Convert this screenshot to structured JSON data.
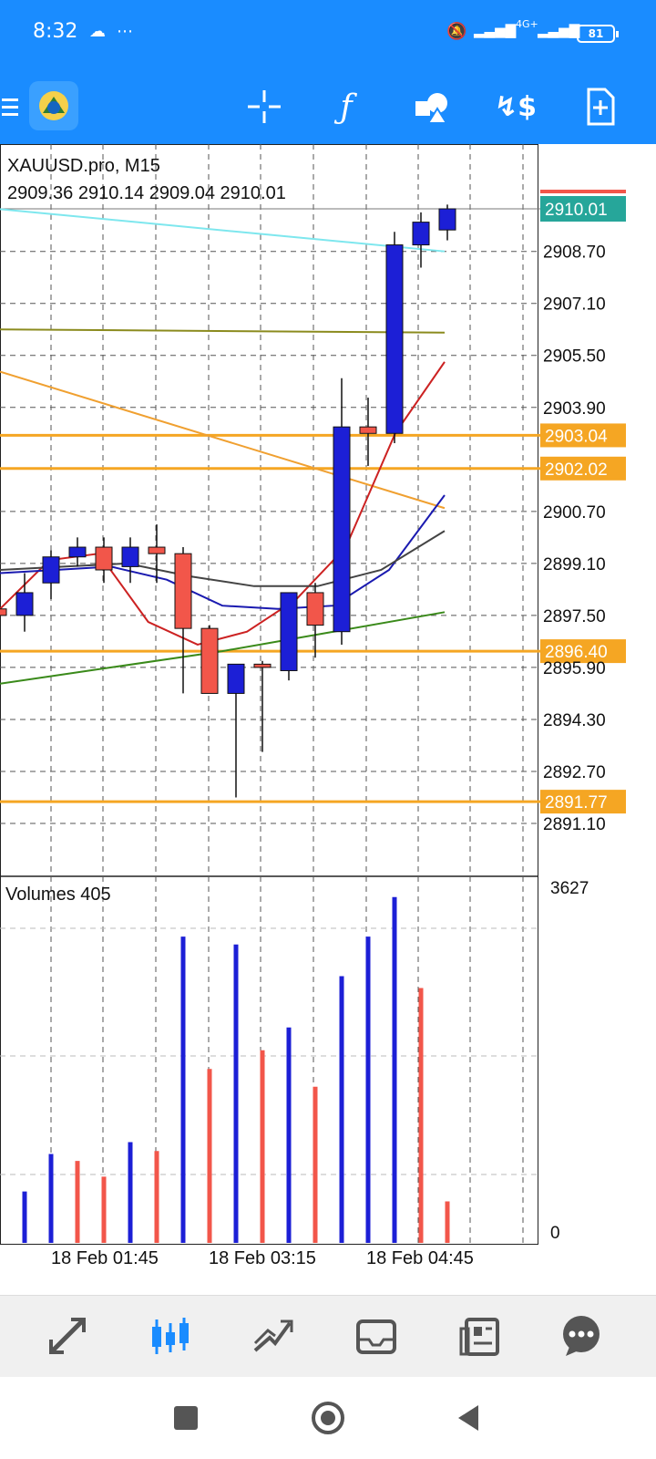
{
  "status_bar": {
    "time": "8:32",
    "network": "4G+",
    "battery": "81",
    "icons": [
      "cloud-game-icon",
      "more-dots-icon",
      "bell-muted-icon",
      "signal-icon",
      "signal-icon"
    ]
  },
  "toolbar": {
    "icons": [
      "menu-icon",
      "metatrader-logo",
      "crosshair-icon",
      "indicators-icon",
      "objects-icon",
      "trade-icon",
      "new-order-icon"
    ]
  },
  "chart": {
    "symbol": "XAUUSD.pro, M15",
    "ohlc": "2909.36 2910.14 2909.04 2910.01",
    "current_price": "2910.01",
    "price_ticks": [
      "2908.70",
      "2907.10",
      "2905.50",
      "2903.90",
      "2900.70",
      "2899.10",
      "2897.50",
      "2895.90",
      "2894.30",
      "2892.70",
      "2891.10"
    ],
    "levels": [
      {
        "label": "2903.04",
        "value": 2903.04
      },
      {
        "label": "2902.02",
        "value": 2902.02
      },
      {
        "label": "2896.40",
        "value": 2896.4
      },
      {
        "label": "2891.77",
        "value": 2891.77
      }
    ],
    "time_labels": [
      "18 Feb 01:45",
      "18 Feb 03:15",
      "18 Feb 04:45"
    ],
    "volumes_title": "Volumes 405",
    "volume_max_label": "3627",
    "volume_min_label": "0",
    "colors": {
      "bull": "#1c1fd6",
      "bear": "#f2564a",
      "level": "#f5a623",
      "price_tag": "#26a69a"
    }
  },
  "chart_data": {
    "type": "candlestick",
    "title": "XAUUSD.pro, M15",
    "ylim": [
      2890.5,
      2911.0
    ],
    "candles": [
      {
        "o": 2897.7,
        "h": 2898.3,
        "l": 2897.0,
        "c": 2897.5
      },
      {
        "o": 2897.5,
        "h": 2898.8,
        "l": 2897.0,
        "c": 2898.2
      },
      {
        "o": 2898.5,
        "h": 2899.5,
        "l": 2898.0,
        "c": 2899.3
      },
      {
        "o": 2899.3,
        "h": 2899.9,
        "l": 2899.0,
        "c": 2899.6
      },
      {
        "o": 2899.6,
        "h": 2899.9,
        "l": 2898.5,
        "c": 2898.9
      },
      {
        "o": 2899.0,
        "h": 2899.9,
        "l": 2898.5,
        "c": 2899.6
      },
      {
        "o": 2899.6,
        "h": 2900.3,
        "l": 2898.5,
        "c": 2899.4
      },
      {
        "o": 2899.4,
        "h": 2899.6,
        "l": 2895.1,
        "c": 2897.1
      },
      {
        "o": 2897.1,
        "h": 2897.2,
        "l": 2895.1,
        "c": 2895.1
      },
      {
        "o": 2895.1,
        "h": 2896.0,
        "l": 2891.9,
        "c": 2896.0
      },
      {
        "o": 2896.0,
        "h": 2896.1,
        "l": 2893.3,
        "c": 2895.9
      },
      {
        "o": 2895.8,
        "h": 2898.2,
        "l": 2895.5,
        "c": 2898.2
      },
      {
        "o": 2898.2,
        "h": 2898.5,
        "l": 2896.2,
        "c": 2897.2
      },
      {
        "o": 2897.0,
        "h": 2904.8,
        "l": 2896.6,
        "c": 2903.3
      },
      {
        "o": 2903.3,
        "h": 2904.2,
        "l": 2902.1,
        "c": 2903.1
      },
      {
        "o": 2903.1,
        "h": 2909.3,
        "l": 2902.8,
        "c": 2908.9
      },
      {
        "o": 2908.9,
        "h": 2909.9,
        "l": 2908.2,
        "c": 2909.6
      },
      {
        "o": 2909.36,
        "h": 2910.14,
        "l": 2909.04,
        "c": 2910.01
      }
    ],
    "volume_ylim": [
      0,
      3627
    ],
    "volumes": [
      {
        "v": 520,
        "dir": "up"
      },
      {
        "v": 900,
        "dir": "up"
      },
      {
        "v": 830,
        "dir": "down"
      },
      {
        "v": 670,
        "dir": "down"
      },
      {
        "v": 1020,
        "dir": "up"
      },
      {
        "v": 930,
        "dir": "down"
      },
      {
        "v": 3100,
        "dir": "up"
      },
      {
        "v": 1760,
        "dir": "down"
      },
      {
        "v": 3020,
        "dir": "up"
      },
      {
        "v": 1950,
        "dir": "down"
      },
      {
        "v": 2180,
        "dir": "up"
      },
      {
        "v": 1580,
        "dir": "down"
      },
      {
        "v": 2700,
        "dir": "up"
      },
      {
        "v": 3100,
        "dir": "up"
      },
      {
        "v": 3500,
        "dir": "up"
      },
      {
        "v": 2580,
        "dir": "down"
      },
      {
        "v": 420,
        "dir": "down"
      }
    ],
    "moving_averages": [
      {
        "color": "#7ee7ee",
        "points": [
          2910.0,
          2908.7
        ]
      },
      {
        "color": "#8b8b1e",
        "points": [
          2906.3,
          2906.2
        ]
      },
      {
        "color": "#f0a030",
        "points": [
          2905.0,
          2900.8
        ]
      },
      {
        "color": "#cc2222",
        "points": [
          2897.7,
          2899.2,
          2899.4,
          2897.3,
          2896.6,
          2897.0,
          2898.0,
          2899.6,
          2903.1,
          2905.3
        ]
      },
      {
        "color": "#1a1ab0",
        "points": [
          2898.8,
          2898.9,
          2899.0,
          2898.6,
          2897.8,
          2897.7,
          2897.8,
          2898.9,
          2901.2
        ]
      },
      {
        "color": "#444444",
        "points": [
          2898.9,
          2899.0,
          2899.1,
          2898.7,
          2898.4,
          2898.4,
          2898.9,
          2900.1
        ]
      },
      {
        "color": "#3a8a1a",
        "points": [
          2895.4,
          2895.9,
          2896.4,
          2897.0,
          2897.6
        ]
      }
    ]
  },
  "bottom_nav": {
    "items": [
      "quotes-icon",
      "chart-icon",
      "trade-icon",
      "history-icon",
      "news-icon",
      "messages-icon"
    ]
  },
  "system_nav": {
    "items": [
      "recents-square-icon",
      "home-circle-icon",
      "back-triangle-icon"
    ]
  }
}
